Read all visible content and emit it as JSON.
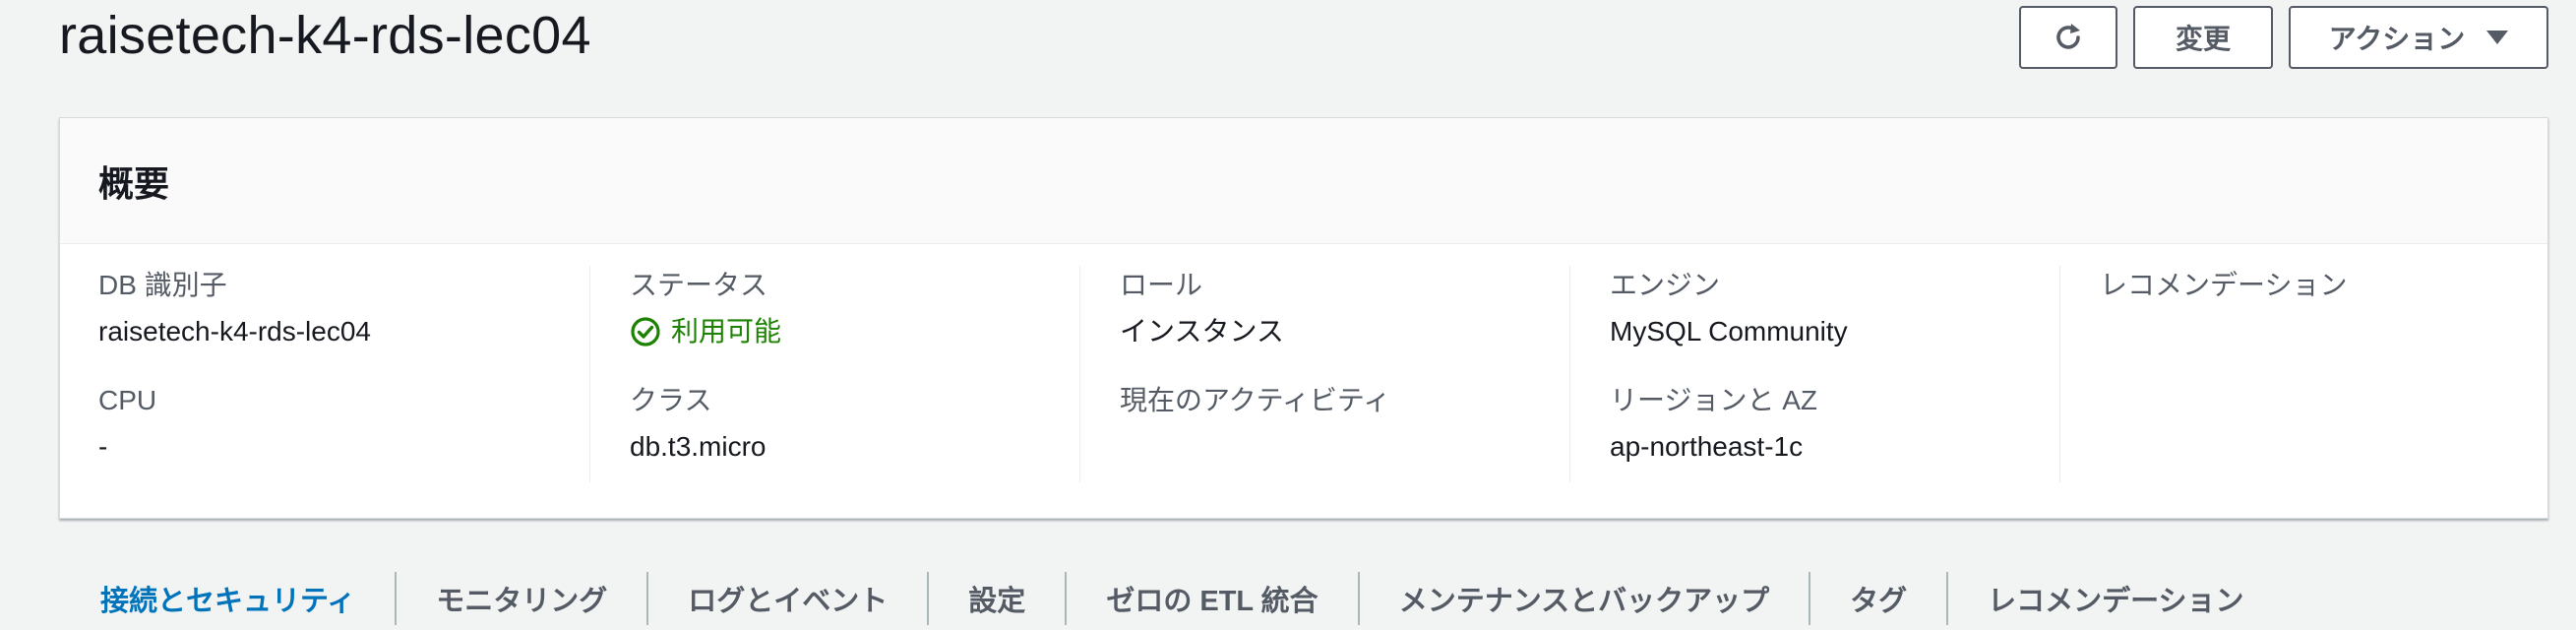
{
  "header": {
    "title": "raisetech-k4-rds-lec04",
    "refresh_icon": "refresh-icon",
    "modify_label": "変更",
    "actions_label": "アクション",
    "actions_icon": "caret-down-icon"
  },
  "summary": {
    "title": "概要",
    "fields": {
      "db_identifier": {
        "label": "DB 識別子",
        "value": "raisetech-k4-rds-lec04"
      },
      "cpu": {
        "label": "CPU",
        "value": "-"
      },
      "status": {
        "label": "ステータス",
        "value": "利用可能",
        "icon": "check-circle-icon",
        "color": "#1d8102"
      },
      "class": {
        "label": "クラス",
        "value": "db.t3.micro"
      },
      "role": {
        "label": "ロール",
        "value": "インスタンス"
      },
      "activity": {
        "label": "現在のアクティビティ",
        "value": ""
      },
      "engine": {
        "label": "エンジン",
        "value": "MySQL Community"
      },
      "region_az": {
        "label": "リージョンと AZ",
        "value": "ap-northeast-1c"
      },
      "recommendations": {
        "label": "レコメンデーション",
        "value": ""
      }
    }
  },
  "tabs": [
    {
      "label": "接続とセキュリティ",
      "active": true
    },
    {
      "label": "モニタリング",
      "active": false
    },
    {
      "label": "ログとイベント",
      "active": false
    },
    {
      "label": "設定",
      "active": false
    },
    {
      "label": "ゼロの ETL 統合",
      "active": false
    },
    {
      "label": "メンテナンスとバックアップ",
      "active": false
    },
    {
      "label": "タグ",
      "active": false
    },
    {
      "label": "レコメンデーション",
      "active": false
    }
  ],
  "colors": {
    "accent": "#0073bb",
    "success": "#1d8102",
    "text": "#16191f",
    "muted": "#545b64"
  }
}
